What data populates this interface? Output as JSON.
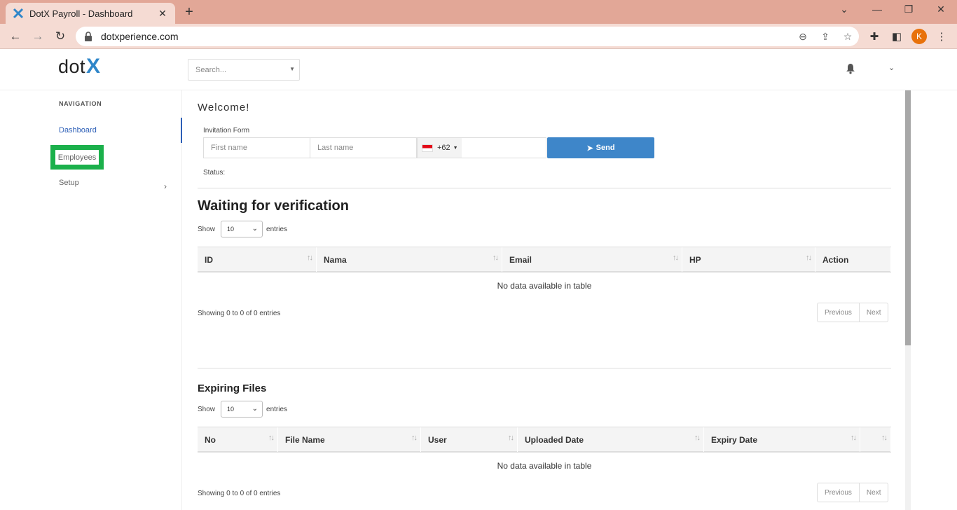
{
  "browser": {
    "tab_title": "DotX Payroll - Dashboard",
    "url": "dotxperience.com",
    "profile_initial": "K"
  },
  "app": {
    "logo_text": "dot",
    "logo_accent": "X",
    "search_placeholder": "Search..."
  },
  "sidebar": {
    "heading": "NAVIGATION",
    "items": [
      {
        "label": "Dashboard"
      },
      {
        "label": "Employees"
      },
      {
        "label": "Setup"
      }
    ]
  },
  "invitation": {
    "welcome": "Welcome!",
    "form_label": "Invitation Form",
    "first_name_placeholder": "First name",
    "last_name_placeholder": "Last name",
    "country_code": "+62",
    "send_label": "Send",
    "status_label": "Status:"
  },
  "verification": {
    "title": "Waiting for verification",
    "show_label": "Show",
    "entries_value": "10",
    "entries_label": "entries",
    "columns": [
      "ID",
      "Nama",
      "Email",
      "HP",
      "Action"
    ],
    "empty_text": "No data available in table",
    "showing_text": "Showing 0 to 0 of 0 entries",
    "prev_label": "Previous",
    "next_label": "Next"
  },
  "expiring": {
    "title": "Expiring Files",
    "show_label": "Show",
    "entries_value": "10",
    "entries_label": "entries",
    "columns": [
      "No",
      "File Name",
      "User",
      "Uploaded Date",
      "Expiry Date",
      ""
    ],
    "empty_text": "No data available in table",
    "showing_text": "Showing 0 to 0 of 0 entries",
    "prev_label": "Previous",
    "next_label": "Next"
  },
  "colors": {
    "accent": "#3e86c9",
    "active_nav": "#2d5fb7",
    "highlight": "#1bb04b"
  }
}
